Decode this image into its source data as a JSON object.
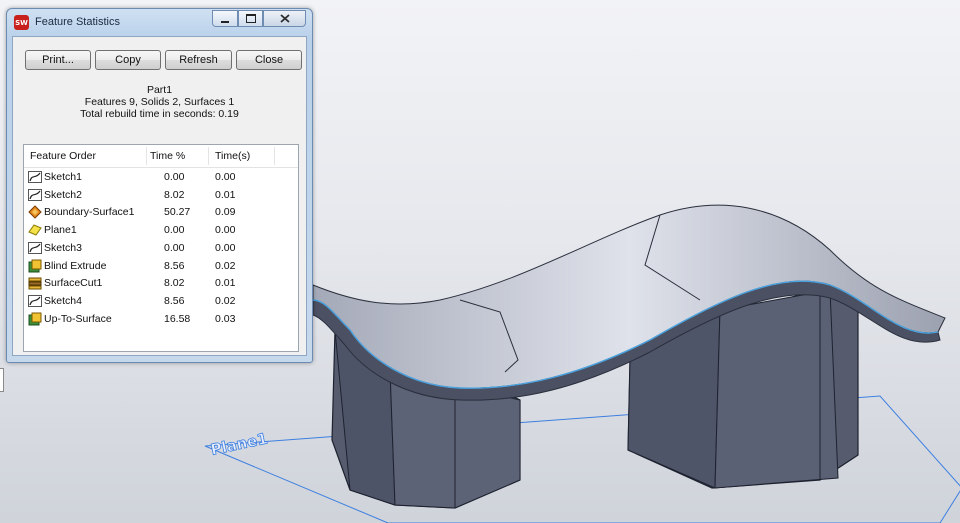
{
  "window": {
    "title": "Feature Statistics",
    "app_icon": "SW",
    "controls": {
      "minimize": "minimize-icon",
      "maximize": "maximize-icon",
      "close": "close-icon"
    }
  },
  "toolbar": {
    "print_label": "Print...",
    "copy_label": "Copy",
    "refresh_label": "Refresh",
    "close_label": "Close"
  },
  "summary": {
    "part_name": "Part1",
    "counts": "Features 9, Solids 2, Surfaces 1",
    "rebuild_time": "Total rebuild time in seconds: 0.19"
  },
  "table": {
    "columns": [
      "Feature Order",
      "Time %",
      "Time(s)"
    ],
    "rows": [
      {
        "icon": "sketch-icon",
        "name": "Sketch1",
        "time_pct": "0.00",
        "time_s": "0.00"
      },
      {
        "icon": "sketch-icon",
        "name": "Sketch2",
        "time_pct": "8.02",
        "time_s": "0.01"
      },
      {
        "icon": "boundary-surface-icon",
        "name": "Boundary-Surface1",
        "time_pct": "50.27",
        "time_s": "0.09"
      },
      {
        "icon": "plane-icon",
        "name": "Plane1",
        "time_pct": "0.00",
        "time_s": "0.00"
      },
      {
        "icon": "sketch-icon",
        "name": "Sketch3",
        "time_pct": "0.00",
        "time_s": "0.00"
      },
      {
        "icon": "extrude-icon",
        "name": "Blind Extrude",
        "time_pct": "8.56",
        "time_s": "0.02"
      },
      {
        "icon": "surface-cut-icon",
        "name": "SurfaceCut1",
        "time_pct": "8.02",
        "time_s": "0.01"
      },
      {
        "icon": "sketch-icon",
        "name": "Sketch4",
        "time_pct": "8.56",
        "time_s": "0.02"
      },
      {
        "icon": "extrude-icon",
        "name": "Up-To-Surface",
        "time_pct": "16.58",
        "time_s": "0.03"
      }
    ]
  },
  "viewport": {
    "plane_label": "Plane1"
  },
  "colors": {
    "titlebar": "#c6d8ec",
    "plane_outline": "#3d7fe0",
    "model_face": "#565c6e",
    "edge_highlight": "#4aa3e0"
  }
}
